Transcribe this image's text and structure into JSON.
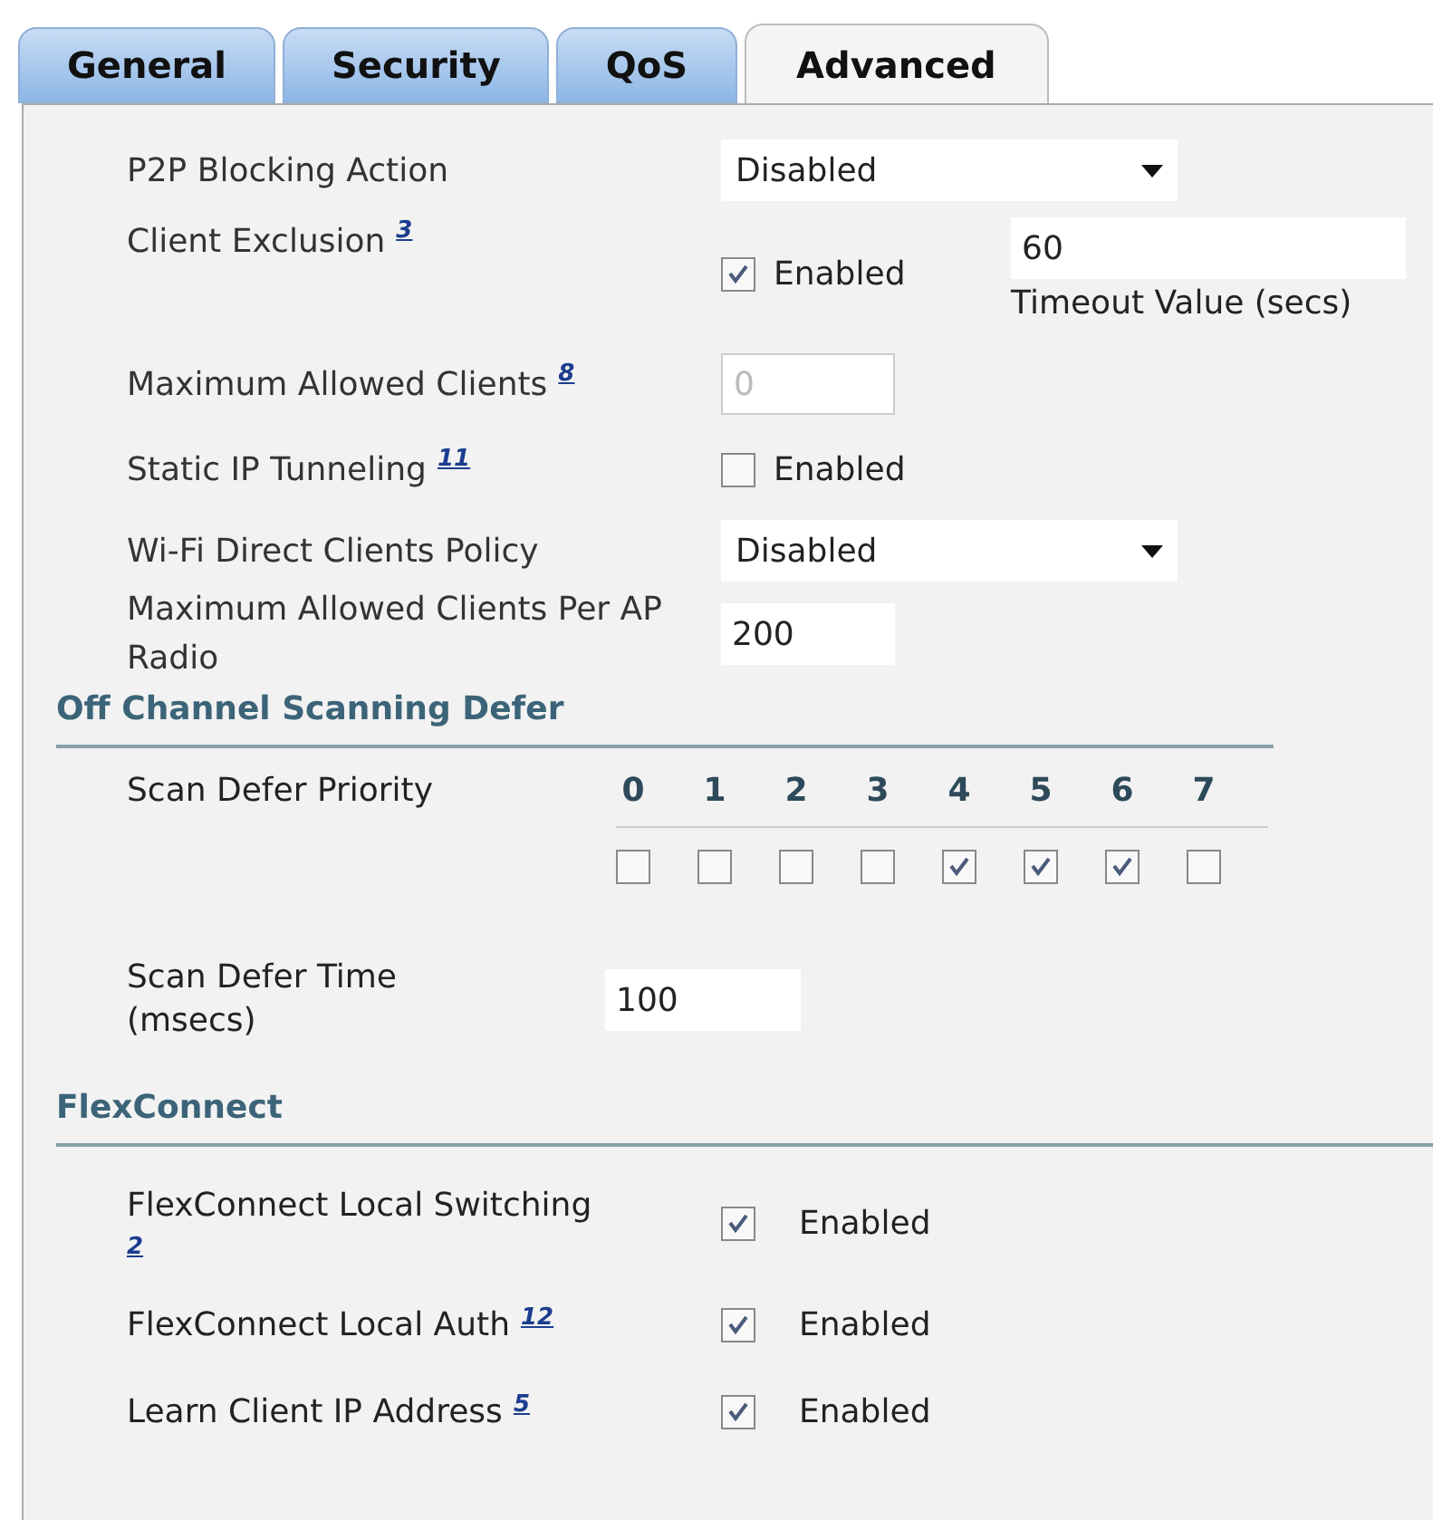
{
  "tabs": [
    {
      "label": "General",
      "selected": false
    },
    {
      "label": "Security",
      "selected": false
    },
    {
      "label": "QoS",
      "selected": false
    },
    {
      "label": "Advanced",
      "selected": true
    }
  ],
  "settings": [
    {
      "kind": "select",
      "label": "P2P Blocking Action",
      "value": "Disabled"
    },
    {
      "kind": "checkbox_timeout",
      "label": "Client Exclusion",
      "footnote": "3",
      "checked": true,
      "option": "Enabled",
      "value": "60",
      "caption": "Timeout Value (secs)"
    },
    {
      "kind": "input",
      "label": "Maximum Allowed Clients",
      "footnote": "8",
      "value": "0",
      "disabled": true
    },
    {
      "kind": "checkbox",
      "label": "Static IP Tunneling",
      "footnote": "11",
      "checked": false,
      "option": "Enabled"
    },
    {
      "kind": "select",
      "label": "Wi-Fi Direct Clients Policy",
      "value": "Disabled"
    },
    {
      "kind": "input",
      "label": "Maximum Allowed Clients Per AP Radio",
      "value": "200",
      "disabled": false
    }
  ],
  "off_channel": {
    "title": "Off Channel Scanning Defer",
    "priority_label": "Scan Defer Priority",
    "priorities": [
      {
        "label": "0",
        "checked": false
      },
      {
        "label": "1",
        "checked": false
      },
      {
        "label": "2",
        "checked": false
      },
      {
        "label": "3",
        "checked": false
      },
      {
        "label": "4",
        "checked": true
      },
      {
        "label": "5",
        "checked": true
      },
      {
        "label": "6",
        "checked": true
      },
      {
        "label": "7",
        "checked": false
      }
    ],
    "time_label": "Scan Defer Time (msecs)",
    "time_value": "100"
  },
  "flexconnect": {
    "title": "FlexConnect",
    "rows": [
      {
        "label": "FlexConnect Local Switching",
        "footnote": "2",
        "checked": true,
        "option": "Enabled"
      },
      {
        "label": "FlexConnect Local Auth",
        "footnote": "12",
        "checked": true,
        "option": "Enabled"
      },
      {
        "label": "Learn Client IP Address",
        "footnote": "5",
        "checked": true,
        "option": "Enabled"
      }
    ]
  }
}
